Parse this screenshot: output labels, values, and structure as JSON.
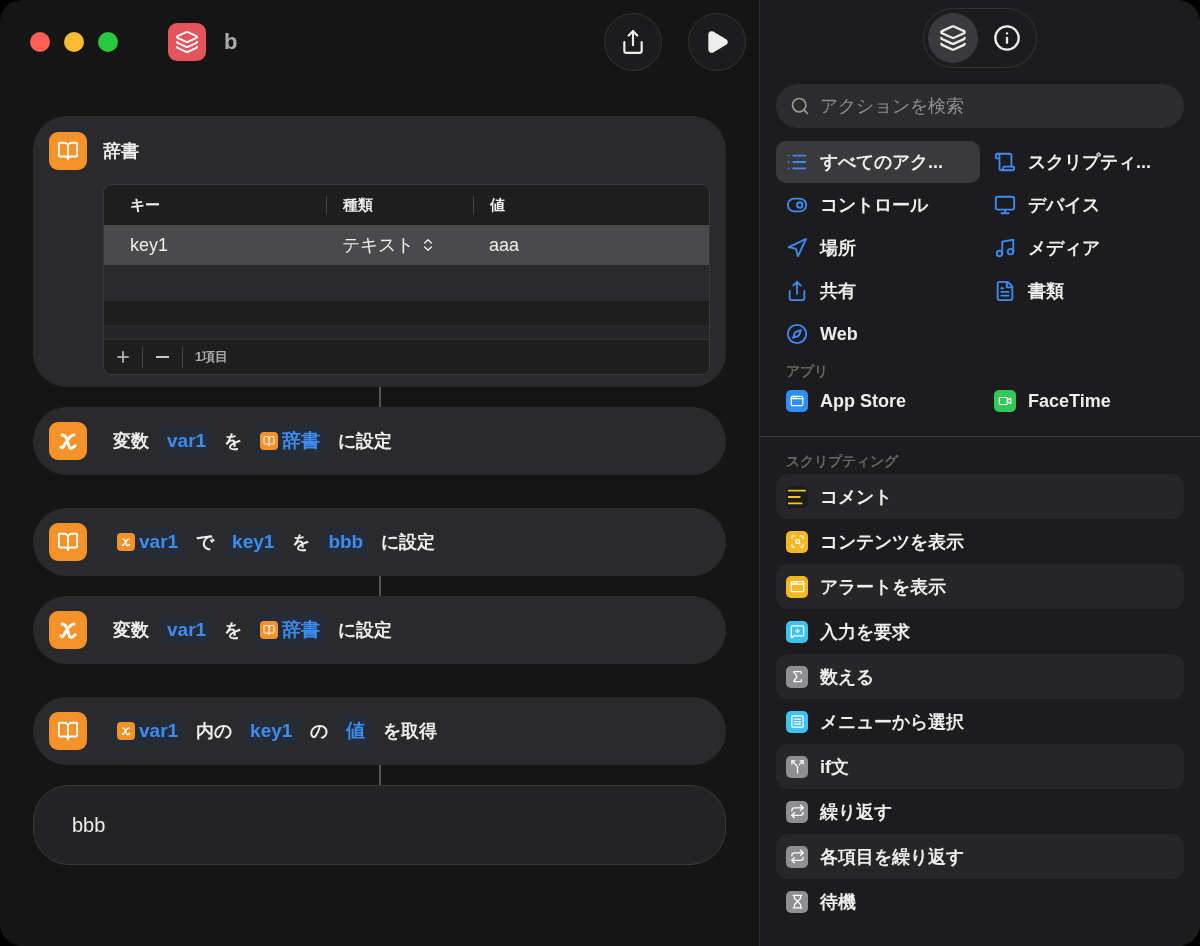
{
  "window": {
    "title": "b"
  },
  "toolbar": {
    "buttons": [
      {
        "kind": "share"
      },
      {
        "kind": "run"
      }
    ]
  },
  "actions": [
    {
      "kind": "dictionary",
      "title": "辞書",
      "table": {
        "columns": [
          "キー",
          "種類",
          "値"
        ],
        "rows": [
          {
            "key": "key1",
            "type": "テキスト",
            "value": "aaa",
            "selected": true
          }
        ],
        "count": "1項目"
      }
    },
    {
      "kind": "set_variable",
      "linked": true,
      "parts": [
        {
          "kind": "text",
          "text": "変数"
        },
        {
          "kind": "token",
          "text": "var1"
        },
        {
          "kind": "text",
          "text": "を"
        },
        {
          "kind": "dictionary_token",
          "text": "辞書"
        },
        {
          "kind": "text",
          "text": "に設定"
        }
      ]
    },
    {
      "kind": "set_value",
      "linked": false,
      "parts": [
        {
          "kind": "variable_token",
          "text": "var1"
        },
        {
          "kind": "text",
          "text": "で"
        },
        {
          "kind": "token",
          "text": "key1"
        },
        {
          "kind": "text",
          "text": "を"
        },
        {
          "kind": "token",
          "text": "bbb"
        },
        {
          "kind": "text",
          "text": "に設定"
        }
      ]
    },
    {
      "kind": "set_variable",
      "linked": true,
      "parts": [
        {
          "kind": "text",
          "text": "変数"
        },
        {
          "kind": "token",
          "text": "var1"
        },
        {
          "kind": "text",
          "text": "を"
        },
        {
          "kind": "dictionary_token",
          "text": "辞書"
        },
        {
          "kind": "text",
          "text": "に設定"
        }
      ]
    },
    {
      "kind": "get_value",
      "linked": false,
      "parts": [
        {
          "kind": "variable_token",
          "text": "var1"
        },
        {
          "kind": "text",
          "text": "内の"
        },
        {
          "kind": "token",
          "text": "key1"
        },
        {
          "kind": "text",
          "text": "の"
        },
        {
          "kind": "token",
          "text": "値"
        },
        {
          "kind": "text",
          "text": "を取得"
        }
      ]
    },
    {
      "kind": "output",
      "linked": true,
      "text": "bbb"
    }
  ],
  "sidebar": {
    "tabs": [
      {
        "kind": "library",
        "selected": true
      },
      {
        "kind": "info",
        "selected": false
      }
    ],
    "search": {
      "placeholder": "アクションを検索"
    },
    "categories": [
      {
        "label": "すべてのアク...",
        "selected": true
      },
      {
        "label": "スクリプティ...",
        "selected": false
      },
      {
        "label": "コントロール",
        "selected": false
      },
      {
        "label": "デバイス",
        "selected": false
      },
      {
        "label": "場所",
        "selected": false
      },
      {
        "label": "メディア",
        "selected": false
      },
      {
        "label": "共有",
        "selected": false
      },
      {
        "label": "書類",
        "selected": false
      },
      {
        "label": "Web",
        "selected": false
      }
    ],
    "apps_heading": "アプリ",
    "apps": [
      {
        "label": "App Store",
        "color": "#2f8ff5"
      },
      {
        "label": "FaceTime",
        "color": "#34c759"
      }
    ],
    "section_heading": "スクリプティング",
    "actions": [
      {
        "label": "コメント",
        "color": "#1c1c1e"
      },
      {
        "label": "コンテンツを表示",
        "color": "#f5b820"
      },
      {
        "label": "アラートを表示",
        "color": "#f5b820"
      },
      {
        "label": "入力を要求",
        "color": "#3ec3f0"
      },
      {
        "label": "数える",
        "color": "#8e8e93"
      },
      {
        "label": "メニューから選択",
        "color": "#3ec3f0"
      },
      {
        "label": "if文",
        "color": "#8e8e93"
      },
      {
        "label": "繰り返す",
        "color": "#8e8e93"
      },
      {
        "label": "各項目を繰り返す",
        "color": "#8e8e93"
      },
      {
        "label": "待機",
        "color": "#8e8e93"
      }
    ]
  }
}
